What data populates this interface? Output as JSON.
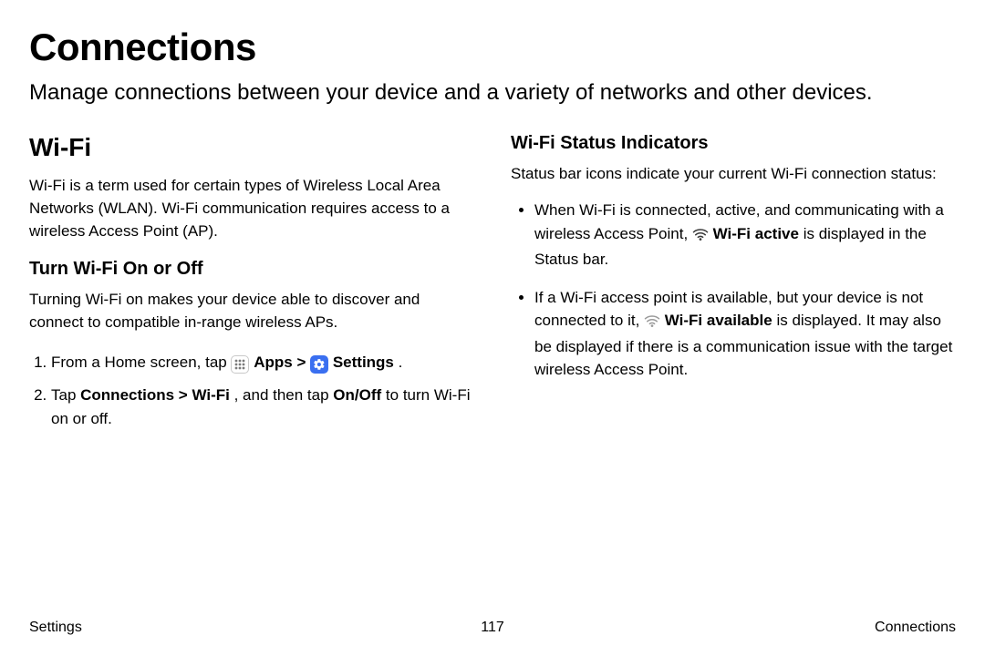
{
  "title": "Connections",
  "subtitle": "Manage connections between your device and a variety of networks and other devices.",
  "left": {
    "h2": "Wi-Fi",
    "intro": "Wi-Fi is a term used for certain types of Wireless Local Area Networks (WLAN). Wi-Fi communication requires access to a wireless Access Point (AP).",
    "turn_h3": "Turn Wi-Fi On or Off",
    "turn_intro": "Turning Wi-Fi on makes your device able to discover and connect to compatible in-range wireless APs.",
    "step1_lead": "From a Home screen, tap ",
    "step1_apps": " Apps",
    "step1_sep": " > ",
    "step1_settings": " Settings",
    "step1_end": ".",
    "step2_lead": "Tap ",
    "step2_bold": "Connections > Wi-Fi",
    "step2_mid": ", and then tap ",
    "step2_bold2": "On/Off",
    "step2_end": "to turn Wi-Fi on or off."
  },
  "right": {
    "h3": "Wi-Fi Status Indicators",
    "intro": "Status bar icons indicate your current Wi-Fi connection status:",
    "b1_lead": "When Wi-Fi is connected, active, and communicating with a wireless Access Point, ",
    "b1_bold": " Wi-Fi active",
    "b1_end": " is displayed in the Status bar.",
    "b2_lead": "If a Wi-Fi access point is available, but your device is not connected to it, ",
    "b2_bold": "Wi-Fi available",
    "b2_end": " is displayed. It may also be displayed if there is a communication issue with the target wireless Access Point."
  },
  "footer": {
    "left": "Settings",
    "center": "117",
    "right": "Connections"
  }
}
